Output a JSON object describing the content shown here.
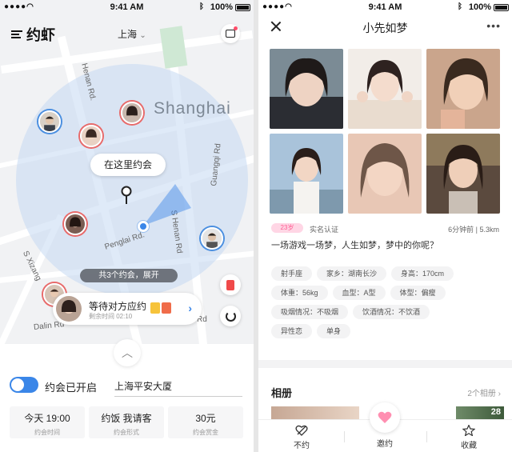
{
  "status": {
    "time": "9:41 AM",
    "battery": "100%"
  },
  "map_screen": {
    "app_name": "约虾",
    "city": "上海",
    "city_caret": "⌄",
    "map_city_label": "Shanghai",
    "streets": [
      "Henan Rd.",
      "Penglai Rd.",
      "S Henan Rd",
      "Guangqi Rd",
      "S Xizang",
      "Dalin Rd",
      "Rd"
    ],
    "tooltip": "在这里约会",
    "expand_pill": "共3个约会，展开",
    "waiting": {
      "title": "等待对方应约",
      "subtitle": "剩余时间 02:10",
      "arrow": "›"
    },
    "expand_chevron": "︿",
    "toggle_label": "约会已开启",
    "address": "上海平安大厦",
    "cards": [
      {
        "value": "今天 19:00",
        "label": "约会时间"
      },
      {
        "value": "约饭 我请客",
        "label": "约会形式"
      },
      {
        "value": "30元",
        "label": "约会赏金"
      }
    ]
  },
  "profile_screen": {
    "title": "小先如梦",
    "more": "•••",
    "badge": "23岁",
    "verified": "实名认证",
    "meta": "6分钟前 | 5.3km",
    "bio": "一场游戏一场梦，人生如梦，梦中的你呢？",
    "tags": [
      [
        "射手座",
        "家乡：湖南长沙",
        "身高：170cm"
      ],
      [
        "体重：56kg",
        "血型：A型",
        "体型：偏瘦"
      ],
      [
        "吸烟情况：不吸烟",
        "饮酒情况：不饮酒"
      ],
      [
        "异性恋",
        "单身"
      ]
    ],
    "album": {
      "title": "相册",
      "count": "2个相册 ›",
      "photo_number": "28"
    },
    "tabs": {
      "left": "不约",
      "center": "邀约",
      "right": "收藏"
    }
  },
  "colors": {
    "accent": "#3a86e8",
    "pink": "#ff5b91",
    "map_circle": "#c5d8f2"
  }
}
